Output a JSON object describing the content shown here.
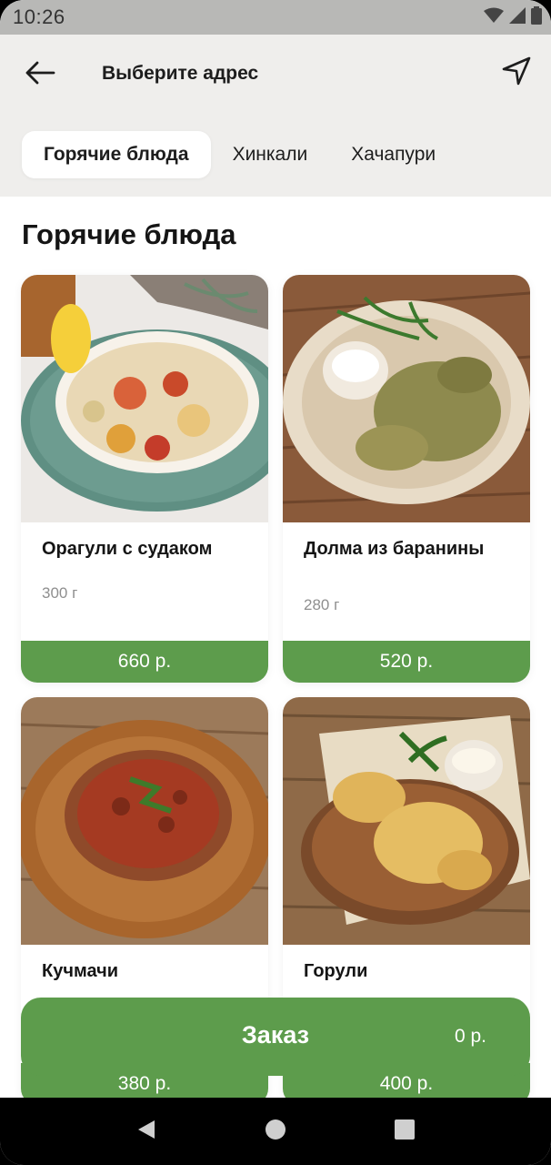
{
  "status_bar": {
    "time": "10:26"
  },
  "header": {
    "title": "Выберите адрес",
    "back_icon": "arrow-left-icon",
    "location_icon": "navigation-arrow-icon"
  },
  "tabs": [
    {
      "label": "Горячие блюда",
      "active": true
    },
    {
      "label": "Хинкали",
      "active": false
    },
    {
      "label": "Хачапури",
      "active": false
    }
  ],
  "section": {
    "title": "Горячие блюда"
  },
  "products": [
    {
      "name": "Орагули с судаком",
      "weight": "300 г",
      "price": "660 р."
    },
    {
      "name": "Долма из баранины",
      "weight": "280 г",
      "price": "520 р."
    },
    {
      "name": "Кучмачи",
      "weight": "",
      "price": "380 р."
    },
    {
      "name": "Горули",
      "weight": "",
      "price": "400 р."
    }
  ],
  "order": {
    "label": "Заказ",
    "total": "0 р."
  },
  "colors": {
    "accent": "#5d9c4c",
    "header_bg": "#efeeec"
  }
}
